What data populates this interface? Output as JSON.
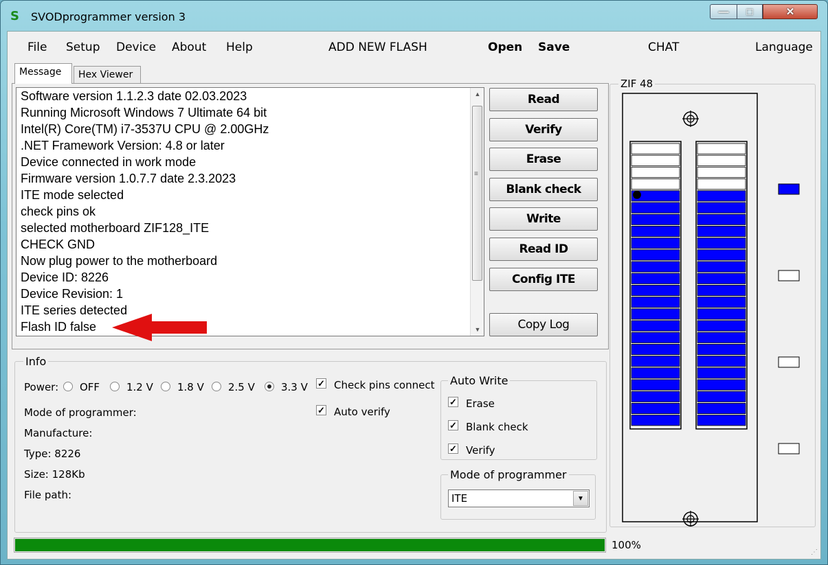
{
  "window": {
    "title": "SVODprogrammer version 3",
    "icon": "S"
  },
  "menu": {
    "items": [
      "File",
      "Setup",
      "Device",
      "About",
      "Help"
    ],
    "add_new_flash": "ADD NEW FLASH",
    "open": "Open",
    "save": "Save",
    "chat": "CHAT",
    "language": "Language"
  },
  "tabs": [
    "Message",
    "Hex Viewer"
  ],
  "log": [
    "Software version 1.1.2.3 date 02.03.2023",
    "Running Microsoft Windows 7 Ultimate  64 bit",
    "Intel(R) Core(TM) i7-3537U CPU @ 2.00GHz",
    ".NET Framework Version: 4.8 or later",
    "Device connected in work mode",
    "Firmware version 1.0.7.7 date 2.3.2023",
    "ITE mode selected",
    "check pins ok",
    "selected motherboard ZIF128_ITE",
    "CHECK GND",
    "Now plug power to the motherboard",
    "Device ID: 8226",
    "Device Revision: 1",
    "ITE series detected",
    "Flash ID false"
  ],
  "buttons": {
    "read": "Read",
    "verify": "Verify",
    "erase": "Erase",
    "blank_check": "Blank check",
    "write": "Write",
    "read_id": "Read ID",
    "config_ite": "Config ITE",
    "copy_log": "Copy Log"
  },
  "info": {
    "label": "Info",
    "power_label": "Power:",
    "power_options": [
      "OFF",
      "1.2 V",
      "1.8 V",
      "2.5 V",
      "3.3 V"
    ],
    "power_selected": "3.3 V",
    "mode_of_programmer": "Mode of programmer:",
    "manufacture": "Manufacture:",
    "type": "Type: 8226",
    "size": "Size: 128Kb",
    "file_path": "File path:",
    "check_pins_connect": "Check pins connect",
    "check_pins_connect_checked": true,
    "auto_verify": "Auto verify",
    "auto_verify_checked": true
  },
  "auto_write": {
    "label": "Auto Write",
    "items": [
      {
        "label": "Erase",
        "checked": true
      },
      {
        "label": "Blank check",
        "checked": true
      },
      {
        "label": "Verify",
        "checked": true
      }
    ]
  },
  "mode_select": {
    "label": "Mode of programmer",
    "value": "ITE"
  },
  "zif": {
    "label": "ZIF 48",
    "pins_per_side": 24,
    "empty_top_pins": 4,
    "active_color": "#0000ff",
    "empty_color": "#ffffff",
    "indicators": [
      true,
      false,
      false,
      false
    ]
  },
  "progress": {
    "value": 100,
    "text": "100%",
    "color": "#0b8a0b"
  },
  "colors": {
    "arrow": "#e01010"
  }
}
